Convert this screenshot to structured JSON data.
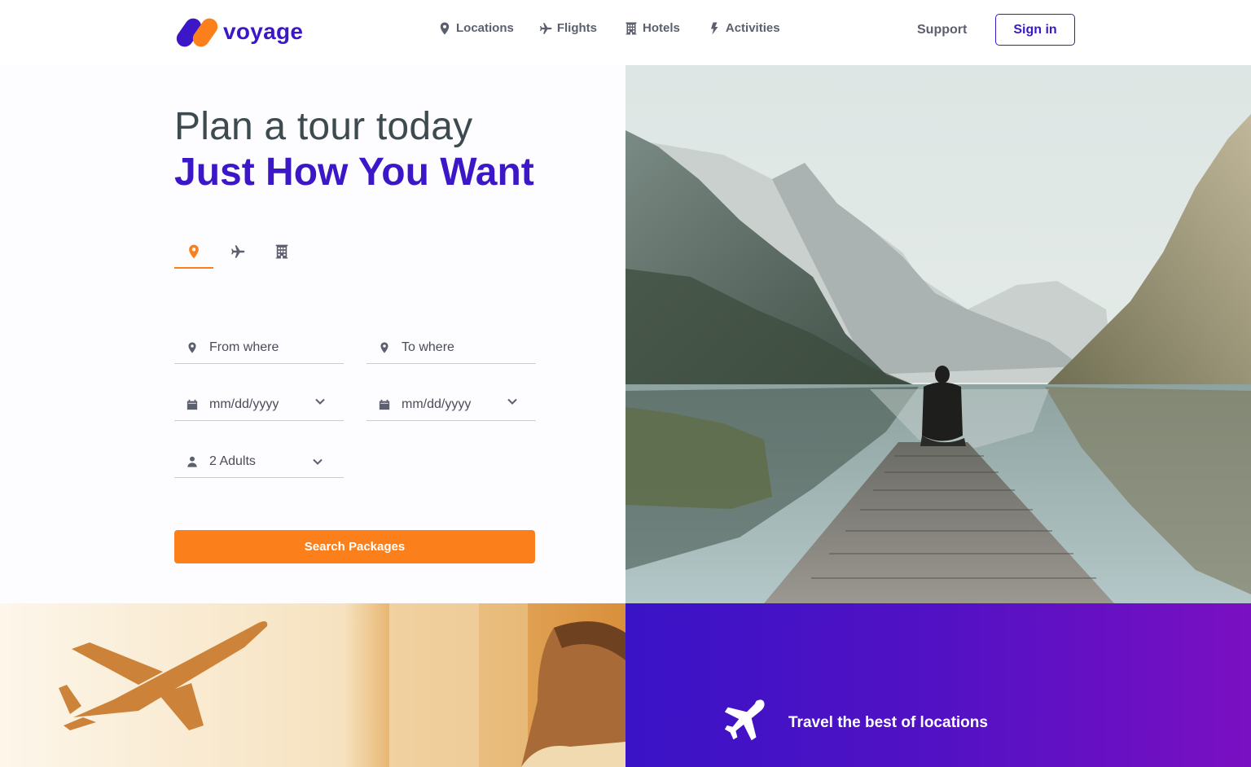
{
  "brand": {
    "name": "voyage",
    "primary_color": "#3b17c8",
    "accent_color": "#fb7f1b"
  },
  "nav": {
    "items": [
      {
        "label": "Locations",
        "icon": "map-marker-icon"
      },
      {
        "label": "Flights",
        "icon": "airplane-icon"
      },
      {
        "label": "Hotels",
        "icon": "building-icon"
      },
      {
        "label": "Activities",
        "icon": "lightning-icon"
      }
    ],
    "support_label": "Support",
    "signin_label": "Sign in"
  },
  "hero": {
    "title_line1": "Plan a tour today",
    "title_line2": "Just How You Want"
  },
  "search": {
    "tabs": [
      {
        "icon": "map-marker-icon",
        "active": true
      },
      {
        "icon": "airplane-icon",
        "active": false
      },
      {
        "icon": "building-icon",
        "active": false
      }
    ],
    "from_placeholder": "From where",
    "to_placeholder": "To where",
    "depart_date": "mm/dd/yyyy",
    "return_date": "mm/dd/yyyy",
    "travelers": "2 Adults",
    "button_label": "Search Packages"
  },
  "promo": {
    "icon": "airplane-icon",
    "text": "Travel the best of locations"
  }
}
